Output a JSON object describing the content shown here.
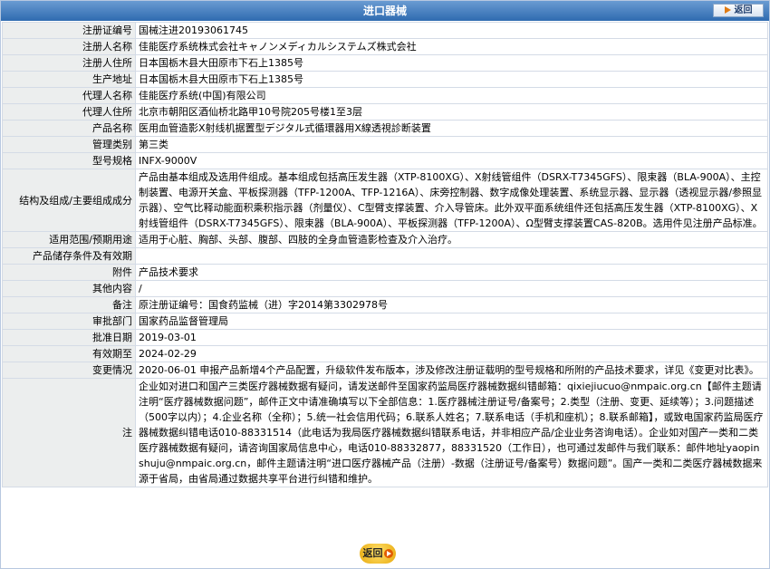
{
  "header": {
    "title": "进口器械",
    "back_label": "返回"
  },
  "rows": [
    {
      "label": "注册证编号",
      "value": "国械注进20193061745"
    },
    {
      "label": "注册人名称",
      "value": "佳能医疗系统株式会社キャノンメディカルシステムズ株式会社"
    },
    {
      "label": "注册人住所",
      "value": "日本国栃木县大田原市下石上1385号"
    },
    {
      "label": "生产地址",
      "value": "日本国栃木县大田原市下石上1385号"
    },
    {
      "label": "代理人名称",
      "value": "佳能医疗系统(中国)有限公司"
    },
    {
      "label": "代理人住所",
      "value": "北京市朝阳区酒仙桥北路甲10号院205号楼1至3层"
    },
    {
      "label": "产品名称",
      "value": "医用血管造影X射线机据置型デジタル式循環器用X線透視診断装置"
    },
    {
      "label": "管理类别",
      "value": "第三类"
    },
    {
      "label": "型号规格",
      "value": "INFX-9000V"
    },
    {
      "label": "结构及组成/主要组成成分",
      "value": "产品由基本组成及选用件组成。基本组成包括高压发生器（XTP-8100XG）、X射线管组件（DSRX-T7345GFS）、限束器（BLA-900A）、主控制装置、电源开关盒、平板探测器（TFP-1200A、TFP-1216A）、床旁控制器、数字成像处理装置、系统显示器、显示器（透视显示器/参照显示器）、空气比释动能面积乘积指示器（剂量仪）、C型臂支撑装置、介入导管床。此外双平面系统组件还包括高压发生器（XTP-8100XG）、X射线管组件（DSRX-T7345GFS）、限束器（BLA-900A）、平板探测器（TFP-1200A）、Ω型臂支撑装置CAS-820B。选用件见注册产品标准。"
    },
    {
      "label": "适用范围/预期用途",
      "value": "适用于心脏、胸部、头部、腹部、四肢的全身血管造影检查及介入治疗。"
    },
    {
      "label": "产品储存条件及有效期",
      "value": ""
    },
    {
      "label": "附件",
      "value": "产品技术要求"
    },
    {
      "label": "其他内容",
      "value": "/"
    },
    {
      "label": "备注",
      "value": "原注册证编号：国食药监械（进）字2014第3302978号"
    },
    {
      "label": "审批部门",
      "value": "国家药品监督管理局"
    },
    {
      "label": "批准日期",
      "value": "2019-03-01"
    },
    {
      "label": "有效期至",
      "value": "2024-02-29"
    },
    {
      "label": "变更情况",
      "value": "2020-06-01 申报产品新增4个产品配置，升级软件发布版本，涉及修改注册证载明的型号规格和所附的产品技术要求，详见《变更对比表》。"
    },
    {
      "label": "注",
      "value": "企业如对进口和国产三类医疗器械数据有疑问，请发送邮件至国家药监局医疗器械数据纠错邮箱：qixiejiucuo@nmpaic.org.cn【邮件主题请注明“医疗器械数据问题”，邮件正文中请准确填写以下全部信息：1.医疗器械注册证号/备案号；2.类型（注册、变更、延续等）；3.问题描述（500字以内）；4.企业名称（全称）；5.统一社会信用代码；6.联系人姓名；7.联系电话（手机和座机）；8.联系邮箱】，或致电国家药监局医疗器械数据纠错电话010-88331514（此电话为我局医疗器械数据纠错联系电话，并非相应产品/企业业务咨询电话）。企业如对国产一类和二类医疗器械数据有疑问，请咨询国家局信息中心，电话010-88332877，88331520（工作日），也可通过发邮件与我们联系：邮件地址yaopinshuju@nmpaic.org.cn，邮件主题请注明“进口医疗器械产品（注册）-数据（注册证号/备案号）数据问题”。国产一类和二类医疗器械数据来源于省局，由省局通过数据共享平台进行纠错和维护。"
    }
  ],
  "footer": {
    "back_label": "返回"
  },
  "colors": {
    "header_bg": "#2f6bb0",
    "label_bg": "#eceeee",
    "border": "#d4dbe6",
    "back_button": "#e8a90c"
  }
}
